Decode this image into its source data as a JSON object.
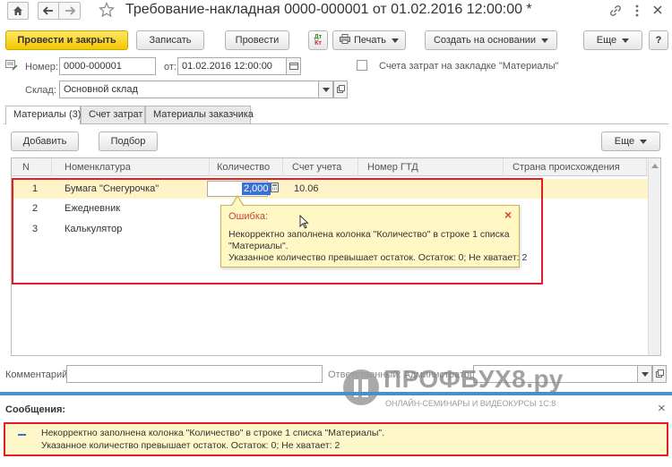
{
  "window": {
    "title": "Требование-накладная 0000-000001 от 01.02.2016 12:00:00 *",
    "home_icon": "home-icon",
    "back_icon": "arrow-left-icon",
    "forward_icon": "arrow-right-icon",
    "favorite_icon": "star-icon",
    "link_icon": "link-icon",
    "more_icon": "vertical-dots-icon",
    "close_icon": "close-icon"
  },
  "toolbar": {
    "post_close_label": "Провести и закрыть",
    "save_label": "Записать",
    "post_label": "Провести",
    "print_label": "Печать",
    "create_based_label": "Создать на основании",
    "more_label": "Еще",
    "help_label": "?"
  },
  "header": {
    "number_label": "Номер:",
    "number_value": "0000-000001",
    "date_label": "от:",
    "date_value": "01.02.2016 12:00:00",
    "cost_account_label": "Счета затрат на закладке \"Материалы\"",
    "warehouse_label": "Склад:",
    "warehouse_value": "Основной склад"
  },
  "tabs": [
    {
      "label": "Материалы (3)"
    },
    {
      "label": "Счет затрат"
    },
    {
      "label": "Материалы заказчика"
    }
  ],
  "table_toolbar": {
    "add_label": "Добавить",
    "pick_label": "Подбор",
    "more_label": "Еще"
  },
  "table": {
    "columns": [
      "N",
      "Номенклатура",
      "Количество",
      "Счет учета",
      "Номер ГТД",
      "Страна происхождения"
    ],
    "rows": [
      {
        "n": "1",
        "item": "Бумага \"Снегурочка\"",
        "qty": "2,000",
        "account": "10.06"
      },
      {
        "n": "2",
        "item": "Ежедневник",
        "qty": "",
        "account": ""
      },
      {
        "n": "3",
        "item": "Калькулятор",
        "qty": "",
        "account": ""
      }
    ]
  },
  "tooltip": {
    "title": "Ошибка:",
    "line1": "Некорректно заполнена колонка \"Количество\" в строке 1 списка",
    "line2": "\"Материалы\".",
    "line3": "Указанное количество превышает остаток. Остаток: 0; Не хватает: 2",
    "close": "×"
  },
  "footer": {
    "comment_label": "Комментарий:",
    "responsible_label": "Ответственный: Администратор"
  },
  "watermark": {
    "brand": "ПРОФБУХ8.ру",
    "tagline": "ОНЛАЙН-СЕМИНАРЫ И ВИДЕОКУРСЫ 1С:8"
  },
  "messages": {
    "title": "Сообщения:",
    "close": "×",
    "line1": "Некорректно заполнена колонка \"Количество\" в строке 1 списка \"Материалы\".",
    "line2": "Указанное количество превышает остаток. Остаток: 0; Не хватает: 2"
  },
  "colors": {
    "accent_yellow": "#f5c800",
    "selected_row": "#fff4c7",
    "tooltip_bg": "#fff7c4",
    "error_red": "#e31e24",
    "messages_bg": "#fdf7c9"
  }
}
